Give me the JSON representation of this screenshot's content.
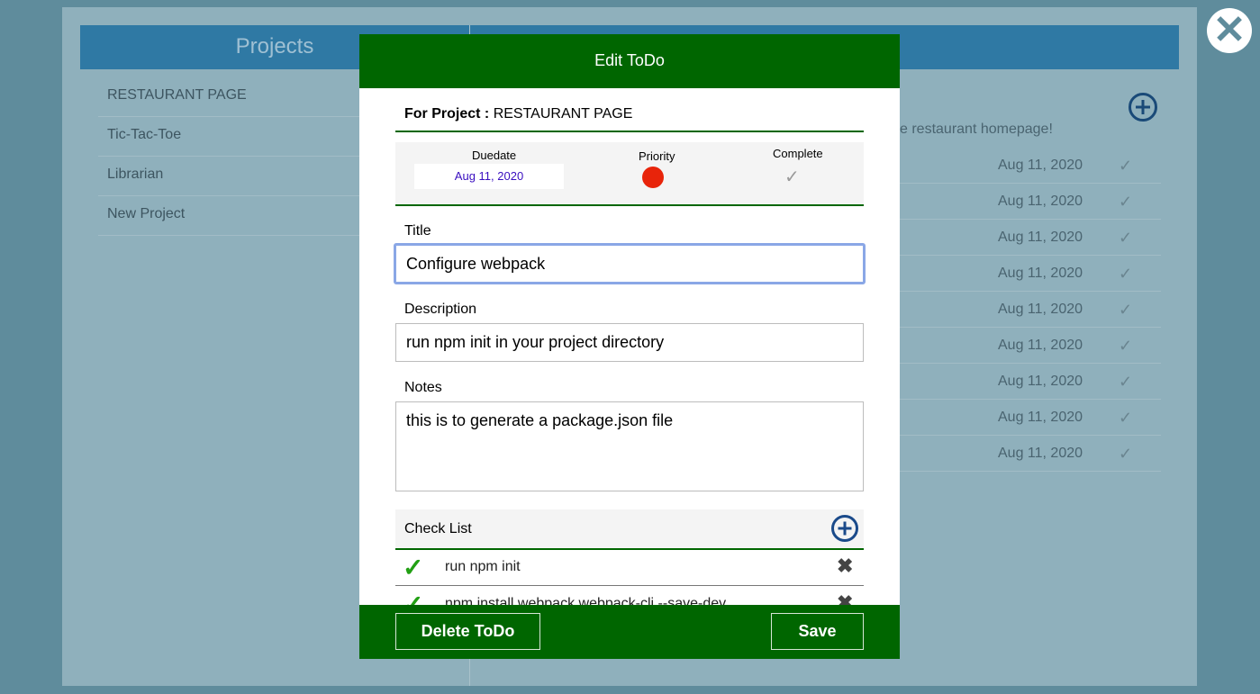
{
  "background": {
    "projects_title": "Projects",
    "projects": [
      "RESTAURANT PAGE",
      "Tic-Tac-Toe",
      "Librarian",
      "New Project"
    ],
    "project_description": "e restaurant homepage!",
    "todo_dates": [
      "Aug 11, 2020",
      "Aug 11, 2020",
      "Aug 11, 2020",
      "Aug 11, 2020",
      "Aug 11, 2020",
      "Aug 11, 2020",
      "Aug 11, 2020",
      "Aug 11, 2020",
      "Aug 11, 2020"
    ],
    "check_glyph": "✓"
  },
  "close_glyph": "✕",
  "modal": {
    "title": "Edit ToDo",
    "for_project_label": "For Project :",
    "for_project_value": "RESTAURANT PAGE",
    "duedate_label": "Duedate",
    "duedate_value": "Aug 11, 2020",
    "priority_label": "Priority",
    "priority_color": "#e8240a",
    "complete_label": "Complete",
    "complete_glyph": "✓",
    "title_label": "Title",
    "title_value": "Configure webpack",
    "description_label": "Description",
    "description_value": "run npm init in your project directory",
    "notes_label": "Notes",
    "notes_value": "this is to generate a package.json file",
    "checklist_label": "Check List",
    "checklist": [
      {
        "text": "run npm init",
        "done": true
      },
      {
        "text": "npm install webpack webpack-cli --save-dev",
        "done": true
      }
    ],
    "tick_glyph": "✓",
    "remove_glyph": "✖",
    "delete_button": "Delete ToDo",
    "save_button": "Save"
  },
  "colors": {
    "header_green": "#006600",
    "app_blue": "#2f79a4"
  }
}
